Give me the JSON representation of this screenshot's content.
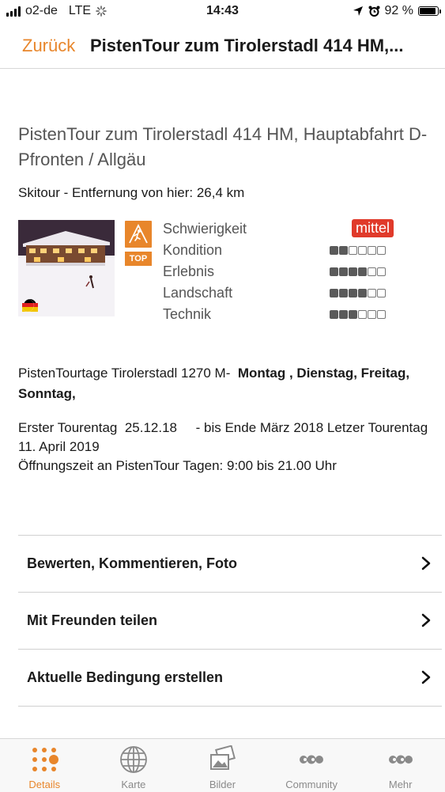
{
  "status_bar": {
    "carrier": "o2-de",
    "network": "LTE",
    "time": "14:43",
    "battery": "92 %"
  },
  "nav": {
    "back": "Zurück",
    "title": "PistenTour zum Tirolerstadl  414 HM,..."
  },
  "tour": {
    "title": "PistenTour zum Tirolerstadl 414 HM, Hauptabfahrt D-Pfronten / Allgäu",
    "subtitle": "Skitour - Entfernung von hier: 26,4 km",
    "badge_label": "TOP",
    "difficulty": {
      "label": "Schwierigkeit",
      "value": "mittel"
    },
    "ratings": [
      {
        "label": "Kondition",
        "value": 2,
        "max": 6
      },
      {
        "label": "Erlebnis",
        "value": 4,
        "max": 6
      },
      {
        "label": "Landschaft",
        "value": 4,
        "max": 6
      },
      {
        "label": "Technik",
        "value": 3,
        "max": 6
      }
    ],
    "days_prefix": "PistenTourtage Tirolerstadl 1270 M-",
    "days_bold": "Montag , Dienstag, Freitag, Sonntag,",
    "info_line1": "Erster Tourentag  25.12.18     - bis Ende März 2018 Letzer Tourentag 11. April 2019",
    "info_line2": "Öffnungszeit an PistenTour Tagen: 9:00 bis 21.00 Uhr"
  },
  "actions": [
    {
      "label": "Bewerten, Kommentieren, Foto"
    },
    {
      "label": "Mit Freunden teilen"
    },
    {
      "label": "Aktuelle Bedingung erstellen"
    }
  ],
  "tabs": [
    {
      "label": "Details",
      "icon": "dots-grid-icon",
      "active": true
    },
    {
      "label": "Karte",
      "icon": "globe-icon",
      "active": false
    },
    {
      "label": "Bilder",
      "icon": "photos-icon",
      "active": false
    },
    {
      "label": "Community",
      "icon": "people-icon",
      "active": false
    },
    {
      "label": "Mehr",
      "icon": "more-icon",
      "active": false
    }
  ],
  "colors": {
    "accent": "#e8862b",
    "difficulty_badge": "#e03a2a"
  }
}
